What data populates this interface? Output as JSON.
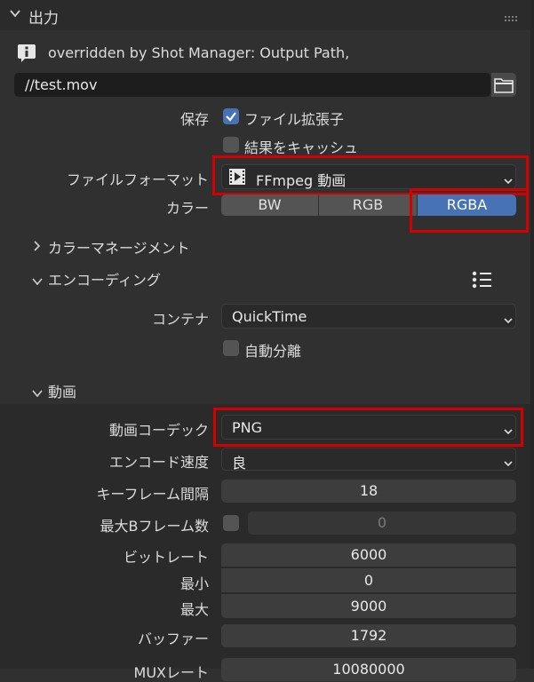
{
  "header": {
    "title": "出力"
  },
  "info": {
    "text": "overridden by Shot Manager: Output Path,"
  },
  "output_path": {
    "value": "//test.mov"
  },
  "save": {
    "label": "保存",
    "file_ext": "ファイル拡張子",
    "cache": "結果をキャッシュ"
  },
  "file_format": {
    "label": "ファイルフォーマット",
    "value": "FFmpeg 動画"
  },
  "color": {
    "label": "カラー",
    "options": [
      "BW",
      "RGB",
      "RGBA"
    ],
    "selected": "RGBA"
  },
  "color_management": {
    "label": "カラーマネージメント"
  },
  "encoding": {
    "label": "エンコーディング",
    "container_label": "コンテナ",
    "container_value": "QuickTime",
    "autosplit": "自動分離"
  },
  "video": {
    "label": "動画",
    "codec_label": "動画コーデック",
    "codec_value": "PNG",
    "speed_label": "エンコード速度",
    "speed_value": "良",
    "keyframe_label": "キーフレーム間隔",
    "keyframe_value": "18",
    "maxb_label": "最大Bフレーム数",
    "maxb_value": "0",
    "bitrate_label": "ビットレート",
    "bitrate_value": "6000",
    "min_label": "最小",
    "min_value": "0",
    "max_label": "最大",
    "max_value": "9000",
    "buffer_label": "バッファー",
    "buffer_value": "1792",
    "mux_label": "MUXレート",
    "mux_value": "10080000"
  },
  "colors": {
    "accent": "#4772b3",
    "highlight": "#d40000"
  }
}
